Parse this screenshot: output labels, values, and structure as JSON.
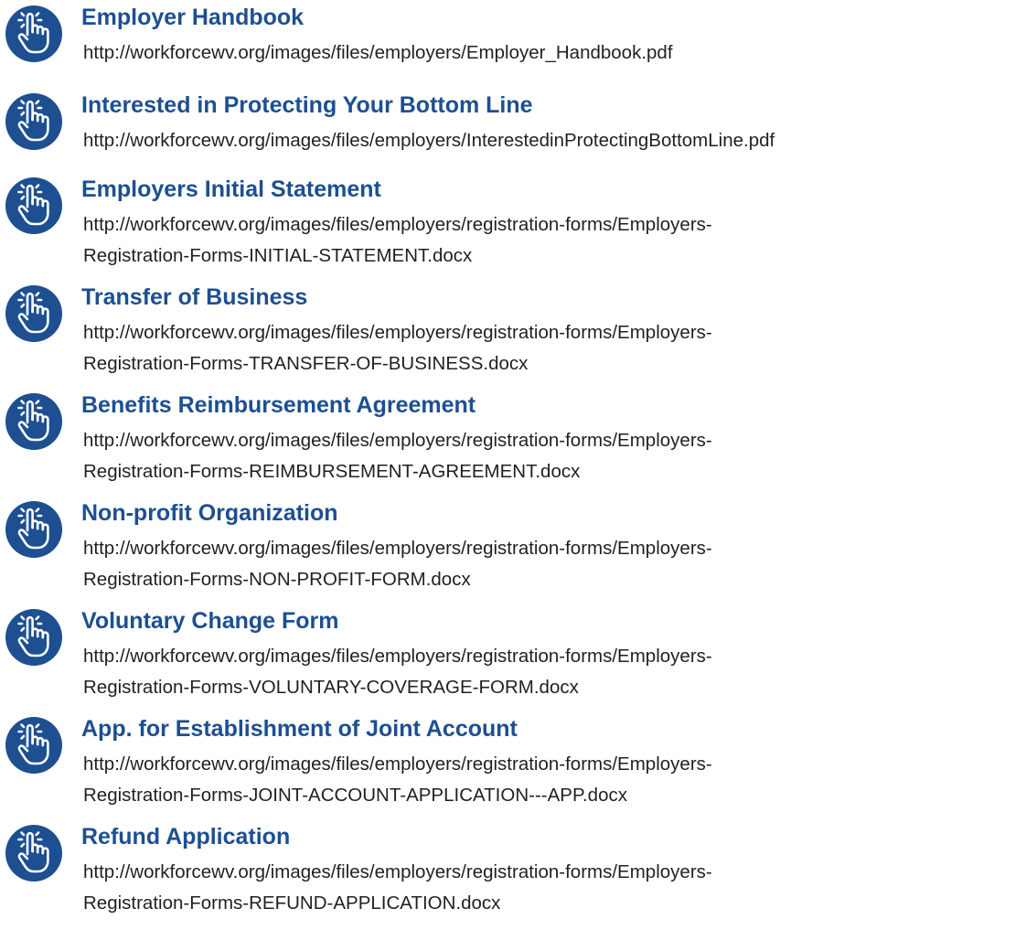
{
  "theme": {
    "accent": "#1d4f91",
    "icon_fill": "#1d4f91",
    "icon_stroke": "#ffffff",
    "text": "#231f20"
  },
  "items": [
    {
      "icon": "pointing-hand-icon",
      "title": "Employer Handbook",
      "url_lines": [
        "http://workforcewv.org/images/files/employers/Employer_Handbook.pdf"
      ]
    },
    {
      "icon": "pointing-hand-icon",
      "title": "Interested in Protecting Your Bottom Line",
      "url_lines": [
        "http://workforcewv.org/images/files/employers/InterestedinProtectingBottomLine.pdf"
      ]
    },
    {
      "icon": "pointing-hand-icon",
      "title": "Employers Initial Statement",
      "url_lines": [
        "http://workforcewv.org/images/files/employers/registration-forms/Employers-",
        "Registration-Forms-INITIAL-STATEMENT.docx"
      ]
    },
    {
      "icon": "pointing-hand-icon",
      "title": "Transfer of Business",
      "url_lines": [
        "http://workforcewv.org/images/files/employers/registration-forms/Employers-",
        "Registration-Forms-TRANSFER-OF-BUSINESS.docx"
      ]
    },
    {
      "icon": "pointing-hand-icon",
      "title": "Benefits Reimbursement Agreement",
      "url_lines": [
        "http://workforcewv.org/images/files/employers/registration-forms/Employers-",
        "Registration-Forms-REIMBURSEMENT-AGREEMENT.docx"
      ]
    },
    {
      "icon": "pointing-hand-icon",
      "title": "Non-profit Organization",
      "url_lines": [
        "http://workforcewv.org/images/files/employers/registration-forms/Employers-",
        "Registration-Forms-NON-PROFIT-FORM.docx"
      ]
    },
    {
      "icon": "pointing-hand-icon",
      "title": "Voluntary Change Form",
      "url_lines": [
        "http://workforcewv.org/images/files/employers/registration-forms/Employers-",
        "Registration-Forms-VOLUNTARY-COVERAGE-FORM.docx"
      ]
    },
    {
      "icon": "pointing-hand-icon",
      "title": "App. for Establishment of Joint Account",
      "url_lines": [
        "http://workforcewv.org/images/files/employers/registration-forms/Employers-",
        "Registration-Forms-JOINT-ACCOUNT-APPLICATION---APP.docx"
      ]
    },
    {
      "icon": "pointing-hand-icon",
      "title": "Refund Application",
      "url_lines": [
        "http://workforcewv.org/images/files/employers/registration-forms/Employers-",
        "Registration-Forms-REFUND-APPLICATION.docx"
      ]
    }
  ]
}
